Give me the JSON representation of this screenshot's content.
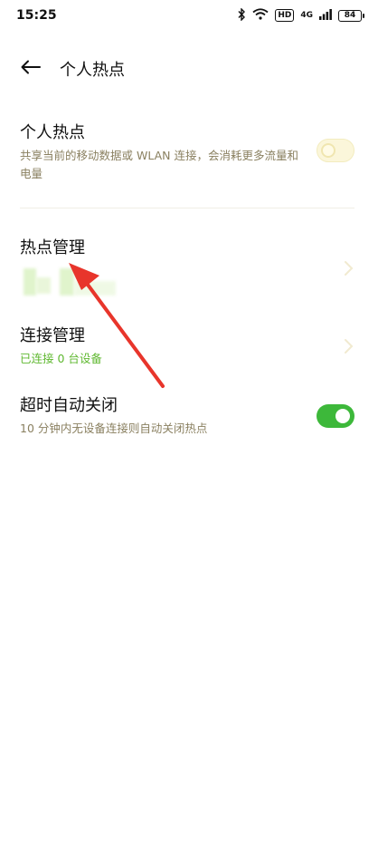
{
  "status_bar": {
    "time": "15:25",
    "icons": [
      "bluetooth-icon",
      "wifi-icon",
      "hd-icon",
      "4g-signal-icon",
      "signal-icon",
      "battery-icon"
    ],
    "hd_label": "HD",
    "network_label": "4G",
    "battery_level": "84"
  },
  "header": {
    "title": "个人热点"
  },
  "hotspot": {
    "title": "个人热点",
    "description": "共享当前的移动数据或 WLAN 连接，会消耗更多流量和电量",
    "enabled": false
  },
  "hotspot_management": {
    "title": "热点管理"
  },
  "connection_management": {
    "title": "连接管理",
    "status": "已连接 0 台设备"
  },
  "auto_close": {
    "title": "超时自动关闭",
    "description": "10 分钟内无设备连接则自动关闭热点",
    "enabled": true
  },
  "colors": {
    "accent_green": "#3db83a",
    "subtext": "#8a8060",
    "connected_green": "#5fb830",
    "annotation_arrow": "#e8352b"
  }
}
